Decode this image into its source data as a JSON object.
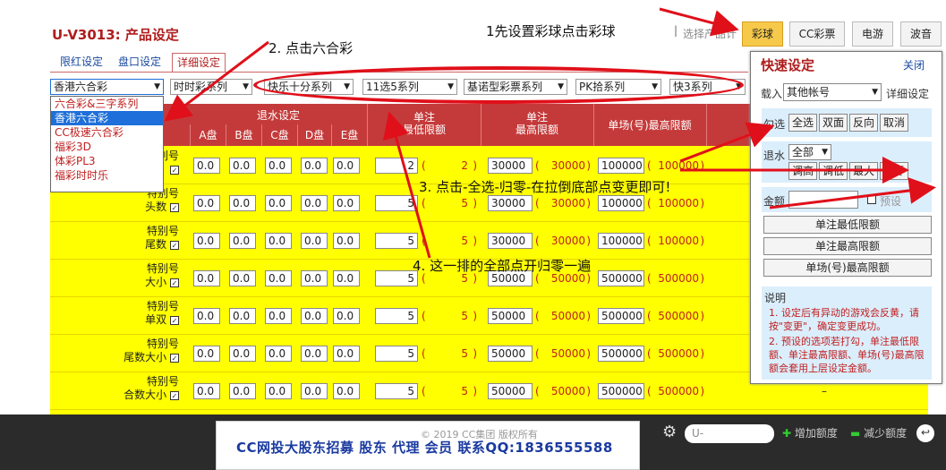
{
  "header": {
    "title": "U-V3013: 产品设定",
    "step1": "1先设置彩球点击彩球",
    "separator": "|",
    "select_products": "选择产品计",
    "buttons": [
      "彩球",
      "CC彩票",
      "电游",
      "波音"
    ]
  },
  "tabs": [
    "限红设定",
    "盘口设定",
    "详细设定"
  ],
  "selects": [
    "香港六合彩",
    "时时彩系列",
    "快乐十分系列",
    "11选5系列",
    "基诺型彩票系列",
    "PK拾系列",
    "快3系列"
  ],
  "dropdown": [
    "六合彩&三字系列",
    "香港六合彩",
    "CC极速六合彩",
    "福彩3D",
    "体彩PL3",
    "福彩时时乐"
  ],
  "table": {
    "rebate_header": "退水设定",
    "sub_headers": [
      "A盘",
      "B盘",
      "C盘",
      "D盘",
      "E盘"
    ],
    "col_min": [
      "单注",
      "最低限额"
    ],
    "col_max": [
      "单注",
      "最高限额"
    ],
    "col_field": "单场(号)最高限额",
    "rows": [
      {
        "l1": "特别号",
        "l2": "",
        "rebates": [
          "0.0",
          "0.0",
          "0.0",
          "0.0",
          "0.0"
        ],
        "min": "2",
        "min_p": "2",
        "max": "30000",
        "max_p": "30000",
        "field": "100000",
        "field_p": "100000"
      },
      {
        "l1": "特别号",
        "l2": "头数",
        "rebates": [
          "0.0",
          "0.0",
          "0.0",
          "0.0",
          "0.0"
        ],
        "min": "5",
        "min_p": "5",
        "max": "30000",
        "max_p": "30000",
        "field": "100000",
        "field_p": "100000"
      },
      {
        "l1": "特别号",
        "l2": "尾数",
        "rebates": [
          "0.0",
          "0.0",
          "0.0",
          "0.0",
          "0.0"
        ],
        "min": "5",
        "min_p": "5",
        "max": "30000",
        "max_p": "30000",
        "field": "100000",
        "field_p": "100000"
      },
      {
        "l1": "特别号",
        "l2": "大小",
        "rebates": [
          "0.0",
          "0.0",
          "0.0",
          "0.0",
          "0.0"
        ],
        "min": "5",
        "min_p": "5",
        "max": "50000",
        "max_p": "50000",
        "field": "500000",
        "field_p": "500000"
      },
      {
        "l1": "特别号",
        "l2": "单双",
        "rebates": [
          "0.0",
          "0.0",
          "0.0",
          "0.0",
          "0.0"
        ],
        "min": "5",
        "min_p": "5",
        "max": "50000",
        "max_p": "50000",
        "field": "500000",
        "field_p": "500000"
      },
      {
        "l1": "特别号",
        "l2": "尾数大小",
        "rebates": [
          "0.0",
          "0.0",
          "0.0",
          "0.0",
          "0.0"
        ],
        "min": "5",
        "min_p": "5",
        "max": "50000",
        "max_p": "50000",
        "field": "500000",
        "field_p": "500000"
      },
      {
        "l1": "特别号",
        "l2": "合数大小",
        "rebates": [
          "0.0",
          "0.0",
          "0.0",
          "0.0",
          "0.0"
        ],
        "min": "5",
        "min_p": "5",
        "max": "50000",
        "max_p": "50000",
        "field": "500000",
        "field_p": "500000"
      }
    ],
    "dash": "–"
  },
  "panel": {
    "title": "快速设定",
    "close": "关闭",
    "account_label": "载入",
    "account_value": "其他帐号",
    "detail": "详细设定",
    "check_label": "勾选",
    "check_buttons": [
      "全选",
      "双面",
      "反向",
      "取消"
    ],
    "rebate_label": "退水",
    "rebate_value": "全部",
    "rebate_buttons": [
      "调高",
      "调低",
      "最大",
      "归零"
    ],
    "amount_label": "金额",
    "preset": "预设",
    "wide_buttons": [
      "单注最低限额",
      "单注最高限额",
      "单场(号)最高限额"
    ],
    "note_title": "说明",
    "notes": [
      "1. 设定后有异动的游戏会反黄，请按\"变更\"，确定变更成功。",
      "2. 预设的选项若打勾，单注最低限额、单注最高限额、单场(号)最高限额会套用上层设定金额。"
    ]
  },
  "annotations": {
    "a2": "2. 点击六合彩",
    "a3": "3. 点击-全选-归零-在拉倒底部点变更即可!",
    "a4": "4. 这一排的全部点开归零一遍"
  },
  "footer": {
    "copyright": "© 2019 CC集团 版权所有",
    "banner": "CC网投大股东招募 股东 代理 会员 联系QQ:1836555588",
    "search_placeholder": "U-",
    "add": "增加额度",
    "reduce": "减少额度"
  },
  "colors": {
    "header_red": "#c43a3a",
    "yellow": "#ffff00",
    "panel_blue": "#dbeefc",
    "active_gold": "#f7c94a"
  }
}
